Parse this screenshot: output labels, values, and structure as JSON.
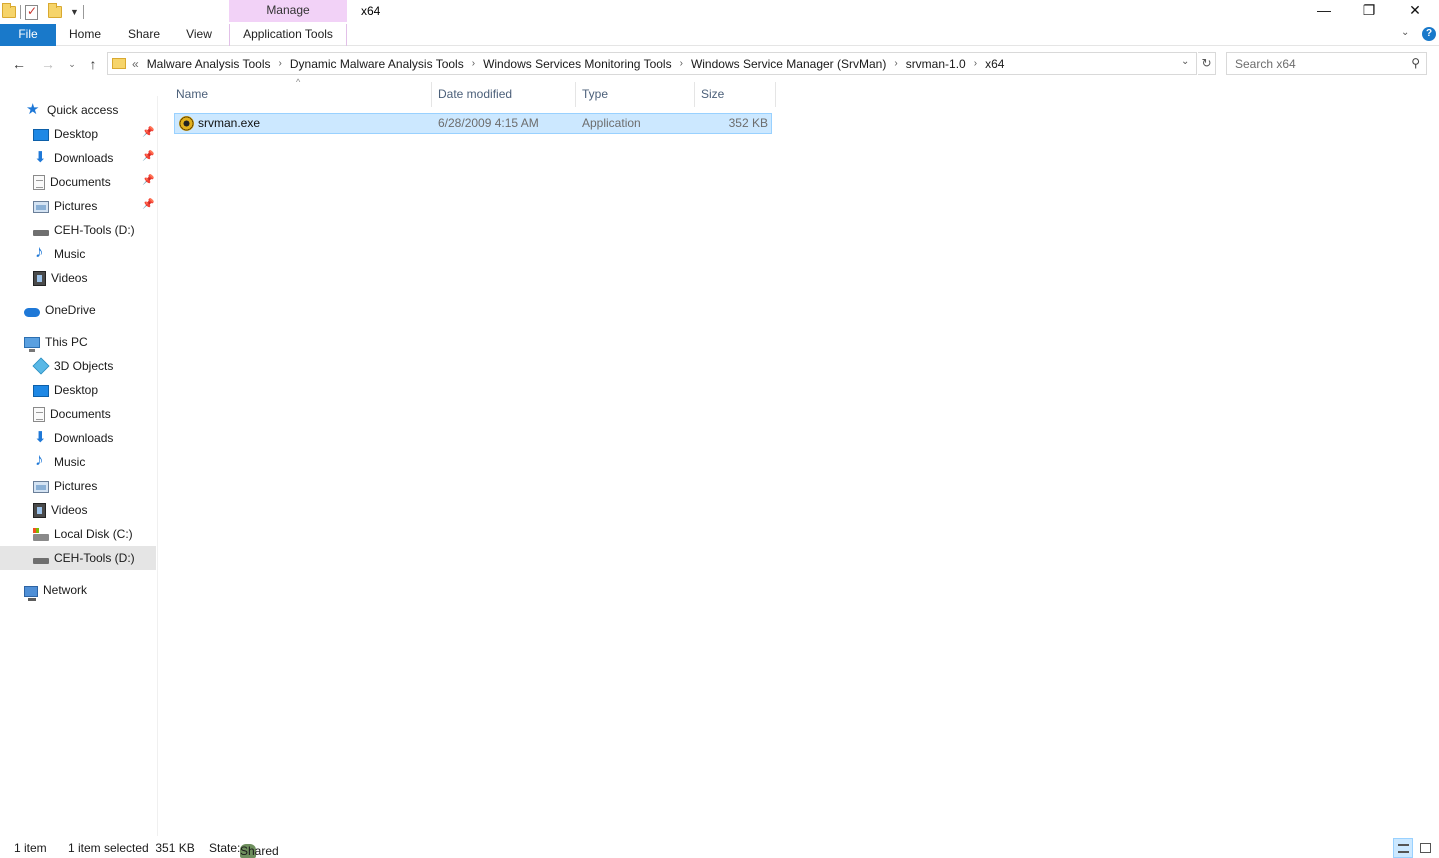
{
  "window": {
    "title": "x64",
    "context_tab": "Manage",
    "controls": {
      "minimize": "—",
      "maximize": "❐",
      "close": "✕"
    }
  },
  "ribbon": {
    "tabs": [
      {
        "label": "File"
      },
      {
        "label": "Home"
      },
      {
        "label": "Share"
      },
      {
        "label": "View"
      },
      {
        "label": "Application Tools"
      }
    ],
    "expand_glyph": "⌄",
    "help_glyph": "?"
  },
  "address": {
    "overflow": "«",
    "crumbs": [
      "Malware Analysis Tools",
      "Dynamic Malware Analysis Tools",
      "Windows Services Monitoring Tools",
      "Windows Service Manager (SrvMan)",
      "srvman-1.0",
      "x64"
    ],
    "separator": "›"
  },
  "search": {
    "placeholder": "Search x64"
  },
  "nav": {
    "quick_access": "Quick access",
    "qa_items": [
      "Desktop",
      "Downloads",
      "Documents",
      "Pictures",
      "CEH-Tools (D:)",
      "Music",
      "Videos"
    ],
    "onedrive": "OneDrive",
    "this_pc": "This PC",
    "pc_items": [
      "3D Objects",
      "Desktop",
      "Documents",
      "Downloads",
      "Music",
      "Pictures",
      "Videos",
      "Local Disk (C:)",
      "CEH-Tools (D:)"
    ],
    "network": "Network"
  },
  "columns": {
    "name": "Name",
    "date": "Date modified",
    "type": "Type",
    "size": "Size"
  },
  "files": [
    {
      "name": "srvman.exe",
      "date": "6/28/2009 4:15 AM",
      "type": "Application",
      "size": "352 KB"
    }
  ],
  "status": {
    "count": "1 item",
    "selected": "1 item selected  351 KB",
    "state_label": "State:",
    "state_value": "Shared"
  },
  "colors": {
    "accent": "#1979ca",
    "selection": "#cce8ff",
    "manage": "#f2d2f7"
  }
}
